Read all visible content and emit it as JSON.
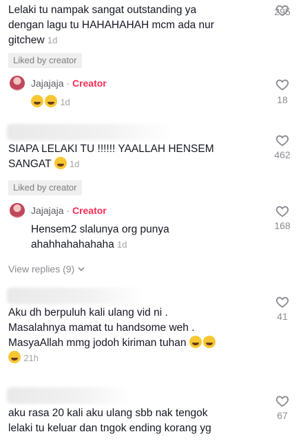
{
  "comments": [
    {
      "text_lines": [
        "Lelaki tu nampak sangat outstanding ya",
        "dengan lagu tu HAHAHAHAH mcm ada nur",
        "gitchew"
      ],
      "time": "1d",
      "liked_label": "Liked by creator",
      "likes": "295",
      "reply": {
        "author": "Jajajaja",
        "dot": "·",
        "badge": "Creator",
        "time": "1d",
        "likes": "18"
      }
    },
    {
      "text_lines": [
        "SIAPA LELAKI TU !!!!!! YAALLAH HENSEM",
        "SANGAT"
      ],
      "time": "1d",
      "liked_label": "Liked by creator",
      "likes": "462",
      "reply": {
        "author": "Jajajaja",
        "dot": "·",
        "badge": "Creator",
        "text_lines": [
          "Hensem2 slalunya org punya",
          "ahahhahahahaha"
        ],
        "time": "1d",
        "likes": "168"
      },
      "view_replies": "View replies (9)"
    },
    {
      "text_lines": [
        "Aku dh berpuluh kali ulang vid ni .",
        "Masalahnya mamat tu handsome weh .",
        "MasyaAllah mmg jodoh kiriman tuhan"
      ],
      "time": "21h",
      "likes": "41"
    },
    {
      "text_lines": [
        "aku rasa 20 kali aku ulang sbb nak tengok",
        "lelaki tu keluar dan tngok ending korang yg"
      ],
      "likes": "67"
    }
  ],
  "icons": {
    "like": "heart-outline-icon",
    "expand": "chevron-down-icon",
    "emoji_laugh": "tears-of-joy-emoji",
    "emoji_cry": "loudly-crying-emoji",
    "emoji_rofl": "rolling-on-floor-laughing-emoji"
  },
  "colors": {
    "creator_badge": "#fe2c55",
    "text": "#161823",
    "muted": "#8a8b91"
  }
}
